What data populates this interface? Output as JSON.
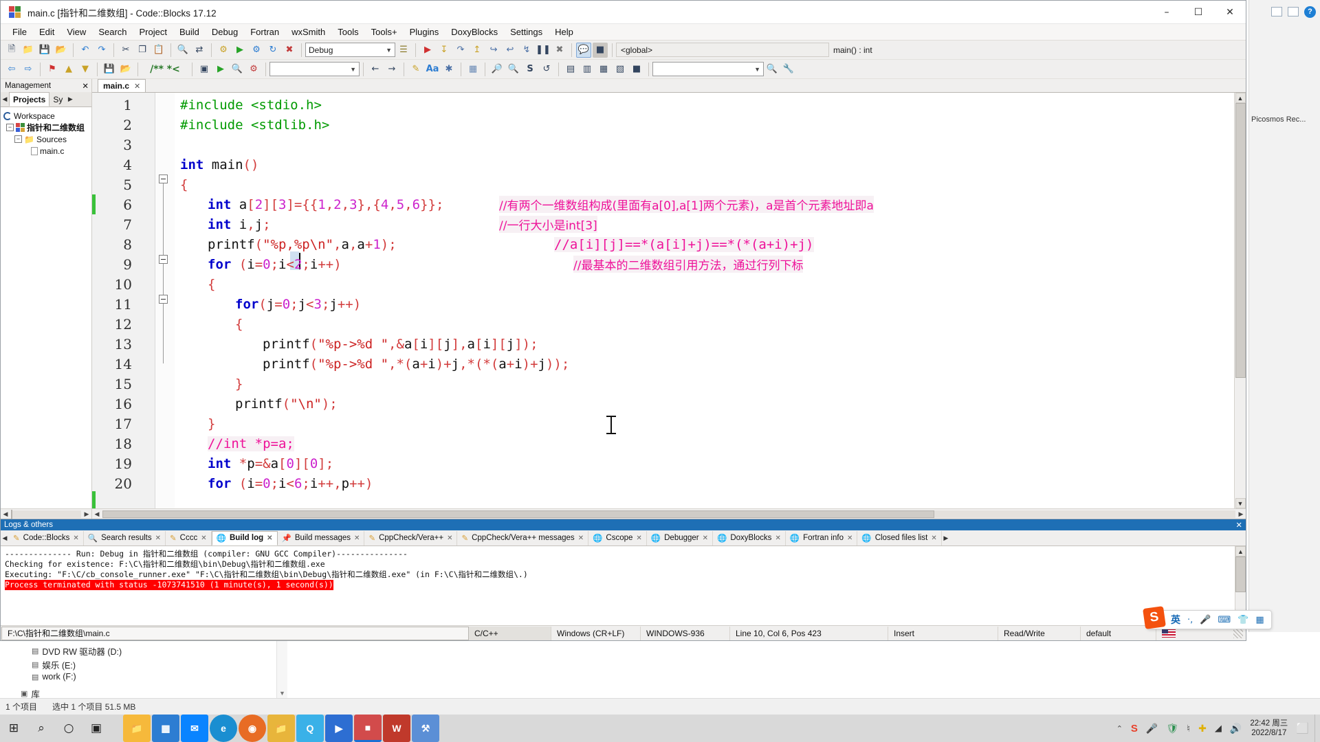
{
  "window": {
    "title": "main.c [指针和二维数组] - Code::Blocks 17.12",
    "minimize": "–",
    "maximize": "☐",
    "close": "✕"
  },
  "menubar": {
    "items": [
      {
        "label": "File"
      },
      {
        "label": "Edit"
      },
      {
        "label": "View"
      },
      {
        "label": "Search"
      },
      {
        "label": "Project"
      },
      {
        "label": "Build"
      },
      {
        "label": "Debug"
      },
      {
        "label": "Fortran"
      },
      {
        "label": "wxSmith"
      },
      {
        "label": "Tools"
      },
      {
        "label": "Tools+"
      },
      {
        "label": "Plugins"
      },
      {
        "label": "DoxyBlocks"
      },
      {
        "label": "Settings"
      },
      {
        "label": "Help"
      }
    ]
  },
  "toolbar": {
    "build_target": "Debug",
    "scope_selector": "<global>",
    "function_selector": "main() : int",
    "row1_icons": [
      "new-file-icon",
      "open-file-icon",
      "save-icon",
      "save-all-icon",
      "undo-icon",
      "redo-icon",
      "cut-icon",
      "copy-icon",
      "paste-icon",
      "find-icon",
      "replace-icon",
      "build-icon",
      "run-icon",
      "build-and-run-icon",
      "rebuild-icon",
      "abort-icon",
      "debug-run-icon",
      "debug-step-into-icon",
      "debug-next-line-icon",
      "debug-step-out-icon",
      "debug-step-instr-icon",
      "debug-run-to-cursor-icon",
      "debug-break-icon",
      "debug-stop-icon",
      "debugging-windows-icon",
      "various-info-icon"
    ],
    "row2_icons": [
      "back-icon",
      "forward-icon",
      "bookmark-toggle-icon",
      "bookmark-prev-icon",
      "bookmark-next-icon",
      "comment-icon",
      "uncomment-icon",
      "doxyblocks-icon",
      "doxyblocks-run-icon",
      "doxyblocks-extract-icon",
      "doxyblocks-config-icon",
      "nav-prev-icon",
      "nav-next-icon",
      "highlight-icon",
      "match-case-icon",
      "regex-icon",
      "zoom-in-icon",
      "zoom-out-icon",
      "zoom-reset-icon",
      "selected-text-icon",
      "indent-icon",
      "wxsmith-icon",
      "panel-left-icon",
      "panel-right-icon",
      "panel-top-icon",
      "panel-bottom-icon",
      "panel-full-icon",
      "search-run-icon",
      "settings-wrench-icon"
    ],
    "search_box_value": ""
  },
  "management": {
    "panel_title": "Management",
    "close_glyph": "✕",
    "tabs": [
      {
        "label": "Projects",
        "active": true
      },
      {
        "label": "Sy",
        "active": false
      }
    ],
    "prev_arrow": "◀",
    "next_arrow": "▶",
    "tree": [
      {
        "label": "Workspace",
        "depth": 0,
        "icon": "workspace-icon",
        "expander": ""
      },
      {
        "label": "指针和二维数组",
        "depth": 1,
        "icon": "project-icon",
        "expander": "−"
      },
      {
        "label": "Sources",
        "depth": 2,
        "icon": "folder-icon",
        "expander": "−"
      },
      {
        "label": "main.c",
        "depth": 3,
        "icon": "file-icon",
        "expander": ""
      }
    ]
  },
  "editor": {
    "tab_label": "main.c",
    "tab_close": "✕",
    "lines": [
      {
        "n": 1,
        "code": "#include <stdio.h>",
        "kind": "preproc"
      },
      {
        "n": 2,
        "code": "#include <stdlib.h>",
        "kind": "preproc"
      },
      {
        "n": 3,
        "code": "",
        "kind": "blank"
      },
      {
        "n": 4,
        "code": "int main()",
        "kind": "code"
      },
      {
        "n": 5,
        "code": "{",
        "kind": "brace"
      },
      {
        "n": 6,
        "code": "    int a[2][3]={{1,2,3},{4,5,6}};",
        "kind": "code",
        "comment": "//有两个一维数组构成(里面有a[0],a[1]两个元素)，a是首个元素地址即a"
      },
      {
        "n": 7,
        "code": "    int i,j;",
        "kind": "code",
        "comment": "//一行大小是int[3]"
      },
      {
        "n": 8,
        "code": "    printf(\"%p,%p\\n\",a,a+1);",
        "kind": "code",
        "comment": "//a[i][j]==*(a[i]+j)==*(*(a+i)+j)"
      },
      {
        "n": 9,
        "code": "    for (i=0;i<2;i++)",
        "kind": "code",
        "comment": "//最基本的二维数组引用方法，通过行列下标"
      },
      {
        "n": 10,
        "code": "    {",
        "kind": "brace",
        "selected": true
      },
      {
        "n": 11,
        "code": "        for(j=0;j<3;j++)",
        "kind": "code"
      },
      {
        "n": 12,
        "code": "        {",
        "kind": "brace"
      },
      {
        "n": 13,
        "code": "            printf(\"%p->%d \",&a[i][j],a[i][j]);",
        "kind": "code"
      },
      {
        "n": 14,
        "code": "            printf(\"%p->%d \",*(a+i)+j,*(*(a+i)+j));",
        "kind": "code"
      },
      {
        "n": 15,
        "code": "        }",
        "kind": "brace"
      },
      {
        "n": 16,
        "code": "        printf(\"\\n\");",
        "kind": "code"
      },
      {
        "n": 17,
        "code": "    }",
        "kind": "brace"
      },
      {
        "n": 18,
        "code": "    //int *p=a;",
        "kind": "comment"
      },
      {
        "n": 19,
        "code": "    int *p=&a[0][0];",
        "kind": "code"
      },
      {
        "n": 20,
        "code": "    for (i=0;i<6;i++,p++)",
        "kind": "code"
      }
    ]
  },
  "logs": {
    "title": "Logs & others",
    "close_glyph": "✕",
    "prev_arrow": "◀",
    "next_arrow": "▶",
    "tabs": [
      {
        "label": "Code::Blocks",
        "icon": "note-icon",
        "active": false
      },
      {
        "label": "Search results",
        "icon": "magnifier-icon",
        "active": false
      },
      {
        "label": "Cccc",
        "icon": "note-icon",
        "active": false
      },
      {
        "label": "Build log",
        "icon": "globe-icon",
        "active": true
      },
      {
        "label": "Build messages",
        "icon": "pin-icon",
        "active": false
      },
      {
        "label": "CppCheck/Vera++",
        "icon": "note-icon",
        "active": false
      },
      {
        "label": "CppCheck/Vera++ messages",
        "icon": "note-icon",
        "active": false
      },
      {
        "label": "Cscope",
        "icon": "globe-icon",
        "active": false
      },
      {
        "label": "Debugger",
        "icon": "globe-icon",
        "active": false
      },
      {
        "label": "DoxyBlocks",
        "icon": "globe-icon",
        "active": false
      },
      {
        "label": "Fortran info",
        "icon": "globe-icon",
        "active": false
      },
      {
        "label": "Closed files list",
        "icon": "globe-icon",
        "active": false
      }
    ],
    "lines": [
      {
        "text": "-------------- Run: Debug in 指针和二维数组 (compiler: GNU GCC Compiler)---------------",
        "error": false
      },
      {
        "text": "Checking for existence: F:\\C\\指针和二维数组\\bin\\Debug\\指针和二维数组.exe",
        "error": false
      },
      {
        "text": "Executing: \"F:\\C/cb_console_runner.exe\" \"F:\\C\\指针和二维数组\\bin\\Debug\\指针和二维数组.exe\"   (in F:\\C\\指针和二维数组\\.)",
        "error": false
      },
      {
        "text": "Process terminated with status -1073741510 (1 minute(s), 1 second(s))",
        "error": true
      }
    ]
  },
  "statusbar": {
    "file_path": "F:\\C\\指针和二维数组\\main.c",
    "language": "C/C++",
    "eol": "Windows (CR+LF)",
    "encoding": "WINDOWS-936",
    "position": "Line 10, Col 6, Pos 423",
    "mode": "Insert",
    "access": "Read/Write",
    "profile": "default"
  },
  "explorer": {
    "picosmos_label": "Picosmos Rec...",
    "help_glyph": "?",
    "tree": [
      {
        "label": "DVD RW 驱动器 (D:)"
      },
      {
        "label": "娱乐 (E:)"
      },
      {
        "label": "work (F:)"
      },
      {
        "label": "库"
      }
    ],
    "status_left": "1 个项目",
    "status_right": "选中 1 个项目  51.5 MB",
    "scroll_down": "▼"
  },
  "ime": {
    "logo_text": "S",
    "mode": "英",
    "punct": "·,",
    "icons": [
      "microphone-icon",
      "keyboard-icon",
      "skin-icon",
      "toolbox-icon"
    ]
  },
  "taskbar": {
    "start_glyph": "⊞",
    "search_glyph": "⌕",
    "cortana_glyph": "○",
    "taskview_glyph": "▣",
    "apps": [
      {
        "name": "file-explorer",
        "glyph": "🗀",
        "color": "#f6b93b"
      },
      {
        "name": "store",
        "glyph": "▣",
        "color": "#2d7dd2"
      },
      {
        "name": "mail",
        "glyph": "✉",
        "color": "#0a84ff"
      },
      {
        "name": "edge-browser",
        "glyph": "e",
        "color": "#1a8ed1"
      },
      {
        "name": "firefox-browser",
        "glyph": "◉",
        "color": "#e86c24"
      },
      {
        "name": "folder-window",
        "glyph": "🗁",
        "color": "#e8b53b"
      },
      {
        "name": "qq-messenger",
        "glyph": "Q",
        "color": "#3ab1e8"
      },
      {
        "name": "video-player",
        "glyph": "▶",
        "color": "#2d6ed2"
      },
      {
        "name": "code-blocks",
        "glyph": "■",
        "color": "#d24b4b"
      },
      {
        "name": "wps-writer",
        "glyph": "W",
        "color": "#c0392b"
      },
      {
        "name": "tool-app",
        "glyph": "⚒",
        "color": "#5b8fd6"
      }
    ],
    "tray": {
      "chevron": "⌃",
      "sogou": "S",
      "icons": [
        "microphone-icon",
        "shield-icon",
        "usb-icon",
        "update-icon",
        "wifi-icon",
        "volume-icon"
      ],
      "time": "22:42 周三",
      "date": "2022/8/17",
      "notification": "⬜"
    }
  }
}
